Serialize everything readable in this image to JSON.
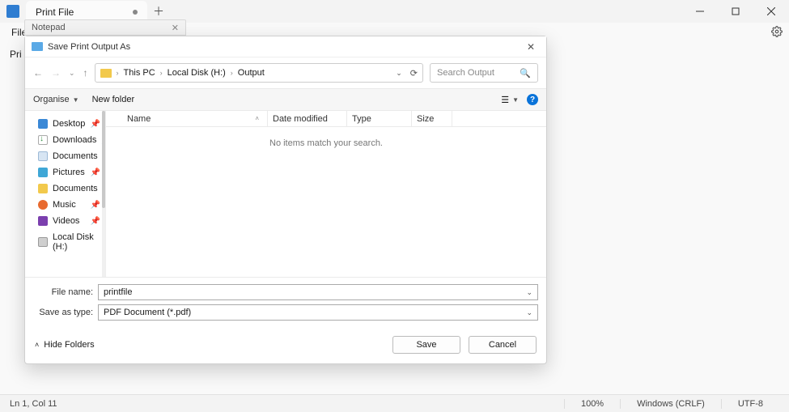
{
  "titlebar": {
    "tab_title": "Print File",
    "secondary_tab": "Notepad"
  },
  "menubar": {
    "file": "File"
  },
  "content_hint": "Pri",
  "statusbar": {
    "position": "Ln 1, Col 11",
    "zoom": "100%",
    "eol": "Windows (CRLF)",
    "encoding": "UTF-8"
  },
  "dialog": {
    "title": "Save Print Output As",
    "breadcrumb": {
      "root": "This PC",
      "drive": "Local Disk (H:)",
      "folder": "Output"
    },
    "search_placeholder": "Search Output",
    "toolbar": {
      "organise": "Organise",
      "new_folder": "New folder"
    },
    "nav_items": [
      "Desktop",
      "Downloads",
      "Documents",
      "Pictures",
      "Documents",
      "Music",
      "Videos",
      "Local Disk (H:)"
    ],
    "columns": {
      "name": "Name",
      "date": "Date modified",
      "type": "Type",
      "size": "Size"
    },
    "empty_message": "No items match your search.",
    "fields": {
      "filename_label": "File name:",
      "filename_value": "printfile",
      "saveas_label": "Save as type:",
      "saveas_value": "PDF Document (*.pdf)"
    },
    "footer": {
      "hide_folders": "Hide Folders",
      "save": "Save",
      "cancel": "Cancel"
    }
  }
}
